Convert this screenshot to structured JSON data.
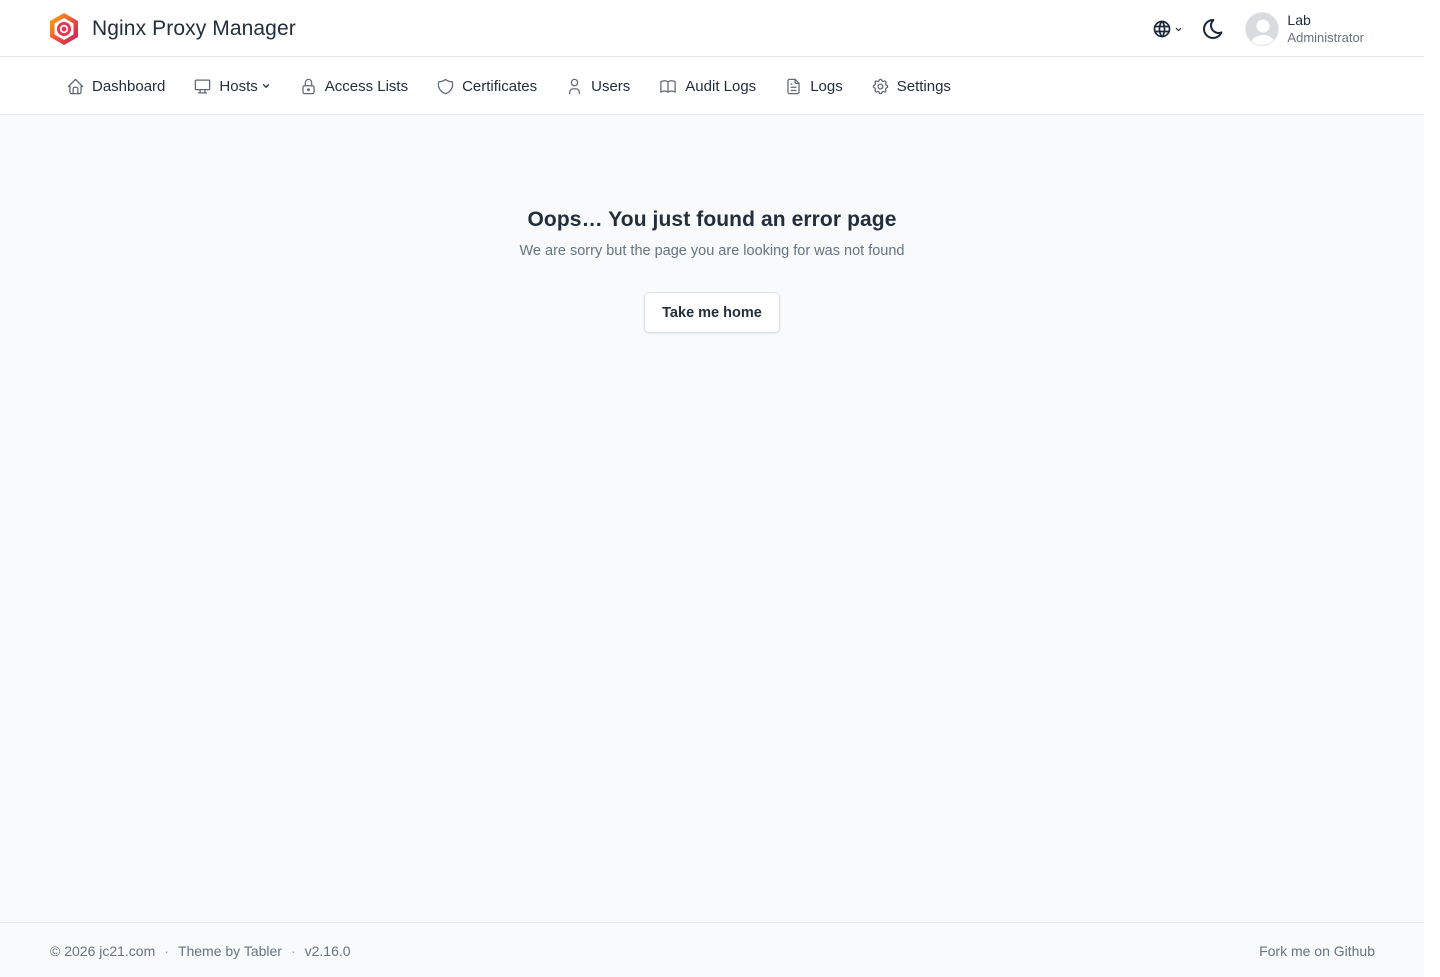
{
  "header": {
    "brand_title": "Nginx Proxy Manager",
    "logo_icon": "nginx-proxy-manager-logo",
    "language_icon": "globe-icon",
    "theme_icon": "moon-icon",
    "user": {
      "name": "Lab",
      "role": "Administrator"
    }
  },
  "nav": {
    "items": [
      {
        "label": "Dashboard",
        "icon": "home-icon"
      },
      {
        "label": "Hosts",
        "icon": "monitor-icon",
        "dropdown": true
      },
      {
        "label": "Access Lists",
        "icon": "lock-icon"
      },
      {
        "label": "Certificates",
        "icon": "shield-icon"
      },
      {
        "label": "Users",
        "icon": "user-icon"
      },
      {
        "label": "Audit Logs",
        "icon": "book-icon"
      },
      {
        "label": "Logs",
        "icon": "file-text-icon"
      },
      {
        "label": "Settings",
        "icon": "gear-icon"
      }
    ]
  },
  "error": {
    "title": "Oops… You just found an error page",
    "subtitle": "We are sorry but the page you are looking for was not found",
    "button_label": "Take me home"
  },
  "footer": {
    "copyright": "© 2026 jc21.com",
    "theme_credit": "Theme by Tabler",
    "version": "v2.16.0",
    "separator": "·",
    "github_link": "Fork me on Github"
  },
  "colors": {
    "text": "#232e3c",
    "muted": "#667382",
    "border": "#e6e8eb",
    "background": "#f8fafc"
  }
}
